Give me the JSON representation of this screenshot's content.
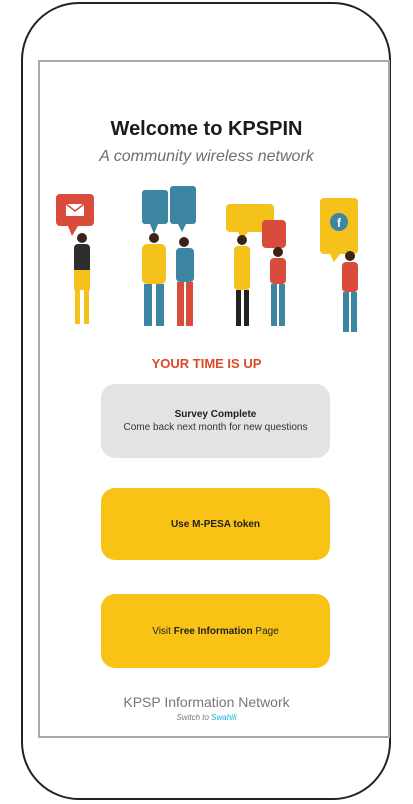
{
  "page": {
    "title": "Welcome to KPSPIN",
    "subtitle": "A community wireless network"
  },
  "status": {
    "message": "YOUR TIME IS UP"
  },
  "survey": {
    "title": "Survey Complete",
    "text": "Come back next month for new questions"
  },
  "buttons": {
    "mpesa_label": "Use M-PESA token",
    "info_prefix": "Visit ",
    "info_bold": "Free Information",
    "info_suffix": " Page"
  },
  "footer": {
    "title": "KPSP Information Network",
    "switch_prefix": "Switch to ",
    "switch_link": "Swahili"
  },
  "colors": {
    "accent_yellow": "#f9c316",
    "alert_orange": "#dc4a27",
    "link_cyan": "#17b2d1",
    "bubble_red": "#d94b3a",
    "bubble_blue": "#3c86a4"
  },
  "icons": [
    "envelope-icon",
    "facebook-icon"
  ]
}
